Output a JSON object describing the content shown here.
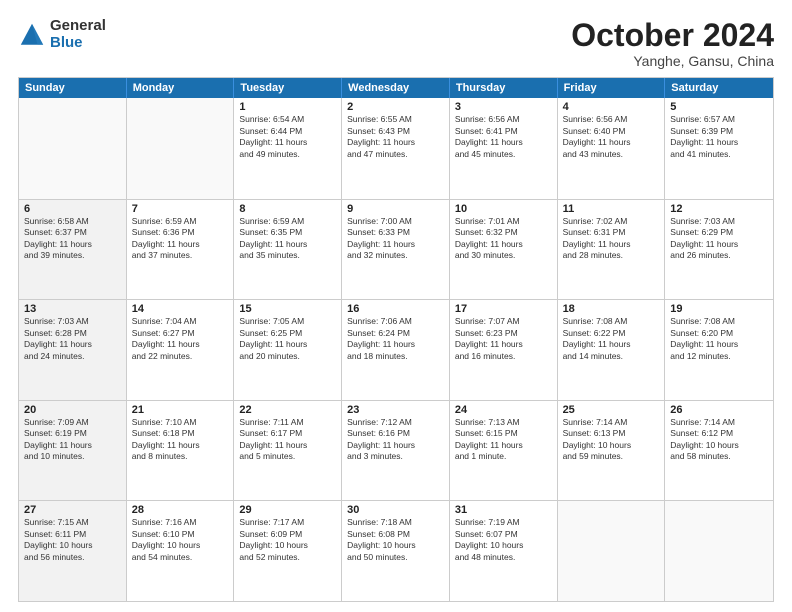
{
  "logo": {
    "general": "General",
    "blue": "Blue"
  },
  "title": "October 2024",
  "location": "Yanghe, Gansu, China",
  "days": [
    "Sunday",
    "Monday",
    "Tuesday",
    "Wednesday",
    "Thursday",
    "Friday",
    "Saturday"
  ],
  "rows": [
    [
      {
        "day": "",
        "empty": true
      },
      {
        "day": "",
        "empty": true
      },
      {
        "day": "1",
        "line1": "Sunrise: 6:54 AM",
        "line2": "Sunset: 6:44 PM",
        "line3": "Daylight: 11 hours",
        "line4": "and 49 minutes."
      },
      {
        "day": "2",
        "line1": "Sunrise: 6:55 AM",
        "line2": "Sunset: 6:43 PM",
        "line3": "Daylight: 11 hours",
        "line4": "and 47 minutes."
      },
      {
        "day": "3",
        "line1": "Sunrise: 6:56 AM",
        "line2": "Sunset: 6:41 PM",
        "line3": "Daylight: 11 hours",
        "line4": "and 45 minutes."
      },
      {
        "day": "4",
        "line1": "Sunrise: 6:56 AM",
        "line2": "Sunset: 6:40 PM",
        "line3": "Daylight: 11 hours",
        "line4": "and 43 minutes."
      },
      {
        "day": "5",
        "line1": "Sunrise: 6:57 AM",
        "line2": "Sunset: 6:39 PM",
        "line3": "Daylight: 11 hours",
        "line4": "and 41 minutes."
      }
    ],
    [
      {
        "day": "6",
        "shaded": true,
        "line1": "Sunrise: 6:58 AM",
        "line2": "Sunset: 6:37 PM",
        "line3": "Daylight: 11 hours",
        "line4": "and 39 minutes."
      },
      {
        "day": "7",
        "line1": "Sunrise: 6:59 AM",
        "line2": "Sunset: 6:36 PM",
        "line3": "Daylight: 11 hours",
        "line4": "and 37 minutes."
      },
      {
        "day": "8",
        "line1": "Sunrise: 6:59 AM",
        "line2": "Sunset: 6:35 PM",
        "line3": "Daylight: 11 hours",
        "line4": "and 35 minutes."
      },
      {
        "day": "9",
        "line1": "Sunrise: 7:00 AM",
        "line2": "Sunset: 6:33 PM",
        "line3": "Daylight: 11 hours",
        "line4": "and 32 minutes."
      },
      {
        "day": "10",
        "line1": "Sunrise: 7:01 AM",
        "line2": "Sunset: 6:32 PM",
        "line3": "Daylight: 11 hours",
        "line4": "and 30 minutes."
      },
      {
        "day": "11",
        "line1": "Sunrise: 7:02 AM",
        "line2": "Sunset: 6:31 PM",
        "line3": "Daylight: 11 hours",
        "line4": "and 28 minutes."
      },
      {
        "day": "12",
        "line1": "Sunrise: 7:03 AM",
        "line2": "Sunset: 6:29 PM",
        "line3": "Daylight: 11 hours",
        "line4": "and 26 minutes."
      }
    ],
    [
      {
        "day": "13",
        "shaded": true,
        "line1": "Sunrise: 7:03 AM",
        "line2": "Sunset: 6:28 PM",
        "line3": "Daylight: 11 hours",
        "line4": "and 24 minutes."
      },
      {
        "day": "14",
        "line1": "Sunrise: 7:04 AM",
        "line2": "Sunset: 6:27 PM",
        "line3": "Daylight: 11 hours",
        "line4": "and 22 minutes."
      },
      {
        "day": "15",
        "line1": "Sunrise: 7:05 AM",
        "line2": "Sunset: 6:25 PM",
        "line3": "Daylight: 11 hours",
        "line4": "and 20 minutes."
      },
      {
        "day": "16",
        "line1": "Sunrise: 7:06 AM",
        "line2": "Sunset: 6:24 PM",
        "line3": "Daylight: 11 hours",
        "line4": "and 18 minutes."
      },
      {
        "day": "17",
        "line1": "Sunrise: 7:07 AM",
        "line2": "Sunset: 6:23 PM",
        "line3": "Daylight: 11 hours",
        "line4": "and 16 minutes."
      },
      {
        "day": "18",
        "line1": "Sunrise: 7:08 AM",
        "line2": "Sunset: 6:22 PM",
        "line3": "Daylight: 11 hours",
        "line4": "and 14 minutes."
      },
      {
        "day": "19",
        "line1": "Sunrise: 7:08 AM",
        "line2": "Sunset: 6:20 PM",
        "line3": "Daylight: 11 hours",
        "line4": "and 12 minutes."
      }
    ],
    [
      {
        "day": "20",
        "shaded": true,
        "line1": "Sunrise: 7:09 AM",
        "line2": "Sunset: 6:19 PM",
        "line3": "Daylight: 11 hours",
        "line4": "and 10 minutes."
      },
      {
        "day": "21",
        "line1": "Sunrise: 7:10 AM",
        "line2": "Sunset: 6:18 PM",
        "line3": "Daylight: 11 hours",
        "line4": "and 8 minutes."
      },
      {
        "day": "22",
        "line1": "Sunrise: 7:11 AM",
        "line2": "Sunset: 6:17 PM",
        "line3": "Daylight: 11 hours",
        "line4": "and 5 minutes."
      },
      {
        "day": "23",
        "line1": "Sunrise: 7:12 AM",
        "line2": "Sunset: 6:16 PM",
        "line3": "Daylight: 11 hours",
        "line4": "and 3 minutes."
      },
      {
        "day": "24",
        "line1": "Sunrise: 7:13 AM",
        "line2": "Sunset: 6:15 PM",
        "line3": "Daylight: 11 hours",
        "line4": "and 1 minute."
      },
      {
        "day": "25",
        "line1": "Sunrise: 7:14 AM",
        "line2": "Sunset: 6:13 PM",
        "line3": "Daylight: 10 hours",
        "line4": "and 59 minutes."
      },
      {
        "day": "26",
        "line1": "Sunrise: 7:14 AM",
        "line2": "Sunset: 6:12 PM",
        "line3": "Daylight: 10 hours",
        "line4": "and 58 minutes."
      }
    ],
    [
      {
        "day": "27",
        "shaded": true,
        "line1": "Sunrise: 7:15 AM",
        "line2": "Sunset: 6:11 PM",
        "line3": "Daylight: 10 hours",
        "line4": "and 56 minutes."
      },
      {
        "day": "28",
        "line1": "Sunrise: 7:16 AM",
        "line2": "Sunset: 6:10 PM",
        "line3": "Daylight: 10 hours",
        "line4": "and 54 minutes."
      },
      {
        "day": "29",
        "line1": "Sunrise: 7:17 AM",
        "line2": "Sunset: 6:09 PM",
        "line3": "Daylight: 10 hours",
        "line4": "and 52 minutes."
      },
      {
        "day": "30",
        "line1": "Sunrise: 7:18 AM",
        "line2": "Sunset: 6:08 PM",
        "line3": "Daylight: 10 hours",
        "line4": "and 50 minutes."
      },
      {
        "day": "31",
        "line1": "Sunrise: 7:19 AM",
        "line2": "Sunset: 6:07 PM",
        "line3": "Daylight: 10 hours",
        "line4": "and 48 minutes."
      },
      {
        "day": "",
        "empty": true
      },
      {
        "day": "",
        "empty": true
      }
    ]
  ]
}
